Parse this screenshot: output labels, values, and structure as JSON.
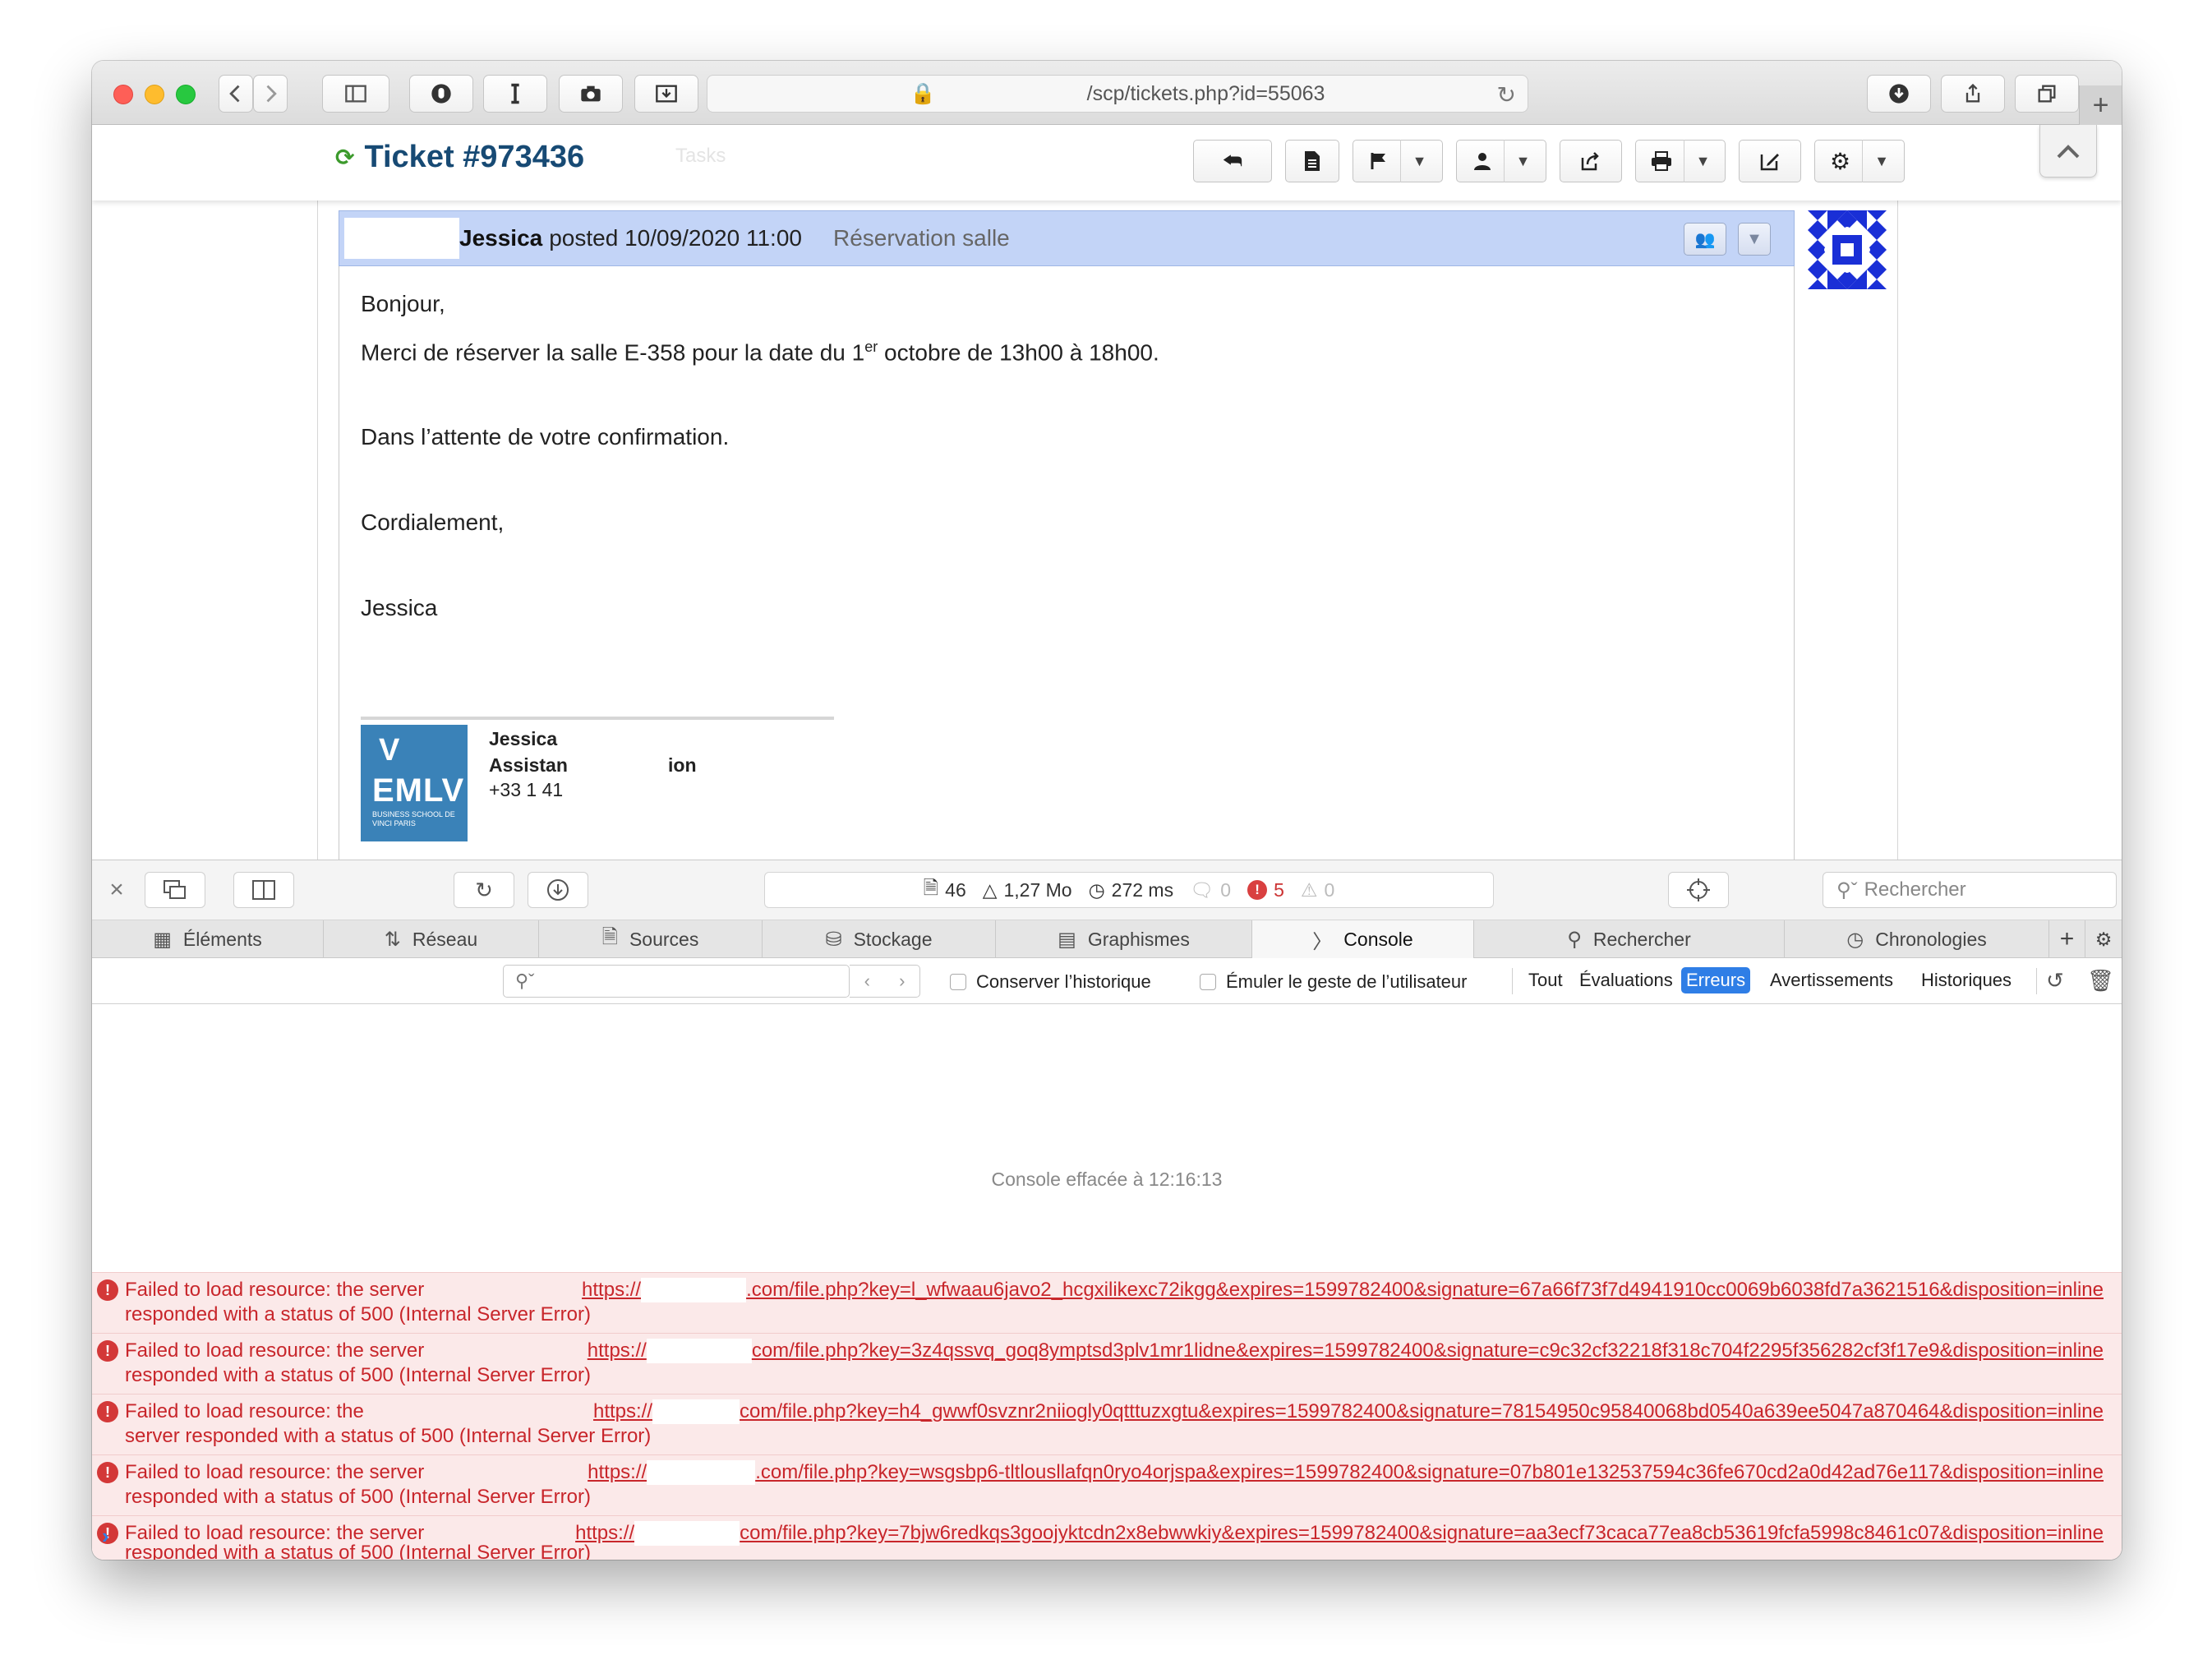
{
  "browser": {
    "address": "/scp/tickets.php?id=55063",
    "new_tab_label": "+"
  },
  "header": {
    "ticket_title": "Ticket #973436",
    "tasks_label": "Tasks"
  },
  "thread": {
    "poster": "Jessica",
    "posted_text": "posted 10/09/2020 11:00",
    "subject": "Réservation salle",
    "body": {
      "greeting": "Bonjour,",
      "line1_before": "Merci de réserver la salle E-358 pour la date du 1",
      "line1_sup": "er",
      "line1_after": " octobre de 13h00 à 18h00.",
      "line2": "Dans l’attente de votre confirmation.",
      "closing": "Cordialement,",
      "sign": "Jessica"
    },
    "signature": {
      "logo_v": "V",
      "logo_name": "EMLV",
      "logo_sub": "BUSINESS SCHOOL DE VINCI PARIS",
      "name": "Jessica",
      "role_start": "Assistan",
      "role_end": "ion",
      "phone": "+33 1 41"
    }
  },
  "inspector": {
    "metrics": {
      "resources": "46",
      "size": "1,27 Mo",
      "time": "272 ms",
      "logs": "0",
      "errors": "5",
      "warnings": "0"
    },
    "search_placeholder": "Rechercher",
    "tabs": [
      "Éléments",
      "Réseau",
      "Sources",
      "Stockage",
      "Graphismes",
      "Console",
      "Rechercher",
      "Chronologies"
    ],
    "filter": {
      "preserve_log": "Conserver l’historique",
      "emulate_gesture": "Émuler le geste de l’utilisateur",
      "levels": [
        "Tout",
        "Évaluations",
        "Erreurs",
        "Avertissements",
        "Historiques"
      ]
    },
    "console": {
      "cleared": "Console effacée à 12:16:13",
      "messages": [
        {
          "t1": "Failed to load resource: the server",
          "t2": "responded with a status of 500 (Internal Server Error)",
          "url_start": "https://",
          "url_end": ".com/file.php?key=l_wfwaau6javo2_hcgxilikexc72ikgg&expires=1599782400&signature=67a66f73f7d4941910cc0069b6038fd7a3621516&disposition=inline"
        },
        {
          "t1": "Failed to load resource: the server",
          "t2": "responded with a status of 500 (Internal Server Error)",
          "url_start": "https://",
          "url_end": "com/file.php?key=3z4qssvq_goq8ymptsd3plv1mr1lidne&expires=1599782400&signature=c9c32cf32218f318c704f2295f356282cf3f17e9&disposition=inline"
        },
        {
          "t1": "Failed to load resource: the",
          "t2": "server responded with a status of 500 (Internal Server Error)",
          "url_start": "https://",
          "url_end": "com/file.php?key=h4_gwwf0svznr2niiogly0qtttuzxgtu&expires=1599782400&signature=78154950c95840068bd0540a639ee5047a870464&disposition=inline"
        },
        {
          "t1": "Failed to load resource: the server",
          "t2": "responded with a status of 500 (Internal Server Error)",
          "url_start": "https://",
          "url_end": ".com/file.php?key=wsgsbp6-tltlousllafqn0ryo4orjspa&expires=1599782400&signature=07b801e132537594c36fe670cd2a0d42ad76e117&disposition=inline"
        },
        {
          "t1": "Failed to load resource: the server",
          "t2": "responded with a status of 500 (Internal Server Error)",
          "url_start": "https://",
          "url_end": "com/file.php?key=7bjw6redkqs3goojyktcdn2x8ebwwkiy&expires=1599782400&signature=aa3ecf73caca77ea8cb53619fcfa5998c8461c07&disposition=inline"
        }
      ]
    }
  }
}
